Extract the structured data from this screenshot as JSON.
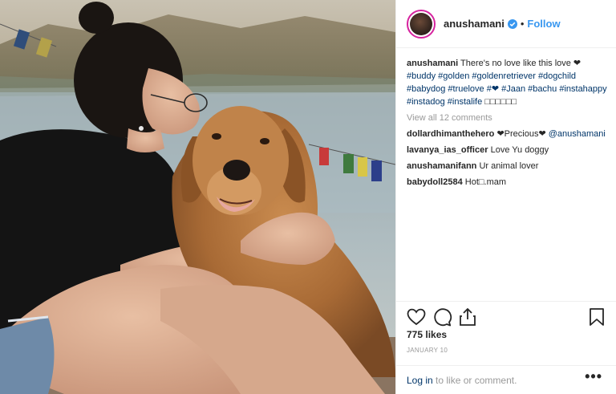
{
  "post": {
    "username": "anushamani",
    "follow_label": "Follow",
    "dot": "•",
    "caption": {
      "text": "There's no love like this love ❤",
      "hashtags": [
        "#buddy",
        "#golden",
        "#goldenretriever",
        "#dogchild",
        "#babydog",
        "#truelove",
        "#❤",
        "#Jaan",
        "#bachu",
        "#instahappy",
        "#instadog",
        "#instalife"
      ],
      "trailing": "□□□□□□"
    },
    "view_all_comments": "View all 12 comments",
    "comments": [
      {
        "user": "dollardhimanthehero",
        "text": "❤Precious❤",
        "mention": "@anushamani"
      },
      {
        "user": "lavanya_ias_officer",
        "text": "Love Yu doggy"
      },
      {
        "user": "anushamanifann",
        "text": "Ur animal lover"
      },
      {
        "user": "babydoll2584",
        "text": "Hot□.mam"
      }
    ],
    "likes": "775 likes",
    "date": "JANUARY 10",
    "login_link": "Log in",
    "login_rest": " to like or comment.",
    "more": "•••"
  },
  "icons": {
    "like": "heart-icon",
    "comment": "comment-bubble-icon",
    "share": "share-icon",
    "save": "bookmark-icon",
    "verified": "verified-badge-icon"
  },
  "colors": {
    "follow": "#3897f0",
    "link": "#003569",
    "muted": "#999999",
    "text": "#262626"
  }
}
